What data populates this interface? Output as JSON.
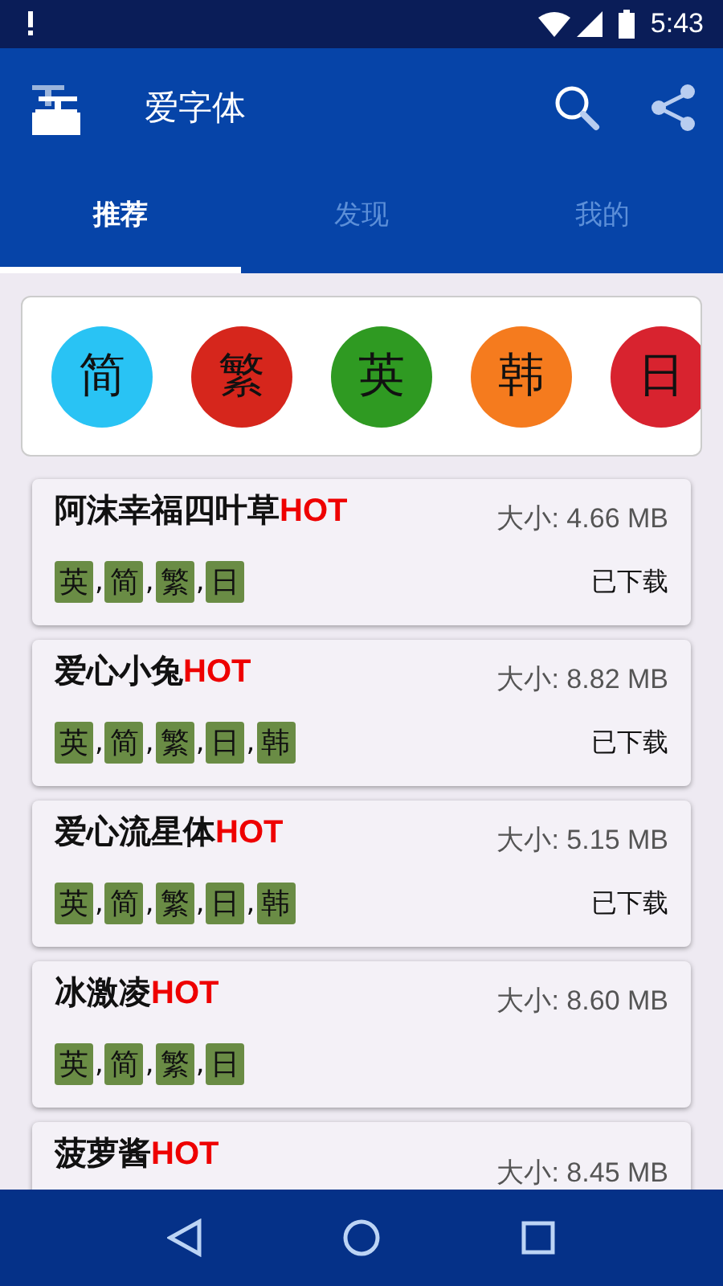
{
  "status_bar": {
    "time": "5:43"
  },
  "app_bar": {
    "title": "爱字体"
  },
  "tabs": [
    {
      "label": "推荐",
      "selected": true
    },
    {
      "label": "发现",
      "selected": false
    },
    {
      "label": "我的",
      "selected": false
    }
  ],
  "categories": [
    {
      "label": "简",
      "color": "#29c3f4"
    },
    {
      "label": "繁",
      "color": "#d6261c"
    },
    {
      "label": "英",
      "color": "#2f9a22"
    },
    {
      "label": "韩",
      "color": "#f57b1e"
    },
    {
      "label": "日",
      "color": "#d8232f"
    }
  ],
  "tag_separator": ",",
  "fonts": [
    {
      "name": "阿沫幸福四叶草",
      "badge": "HOT",
      "size": "大小: 4.66 MB",
      "tags": [
        "英",
        "简",
        "繁",
        "日"
      ],
      "status": "已下载"
    },
    {
      "name": "爱心小兔",
      "badge": "HOT",
      "size": "大小: 8.82 MB",
      "tags": [
        "英",
        "简",
        "繁",
        "日",
        "韩"
      ],
      "status": "已下载"
    },
    {
      "name": "爱心流星体",
      "badge": "HOT",
      "size": "大小: 5.15 MB",
      "tags": [
        "英",
        "简",
        "繁",
        "日",
        "韩"
      ],
      "status": "已下载"
    },
    {
      "name": "冰激凌",
      "badge": "HOT",
      "size": "大小: 8.60 MB",
      "tags": [
        "英",
        "简",
        "繁",
        "日"
      ]
    },
    {
      "name": "菠萝酱",
      "badge": "HOT",
      "size": "大小: 8.45 MB"
    }
  ]
}
